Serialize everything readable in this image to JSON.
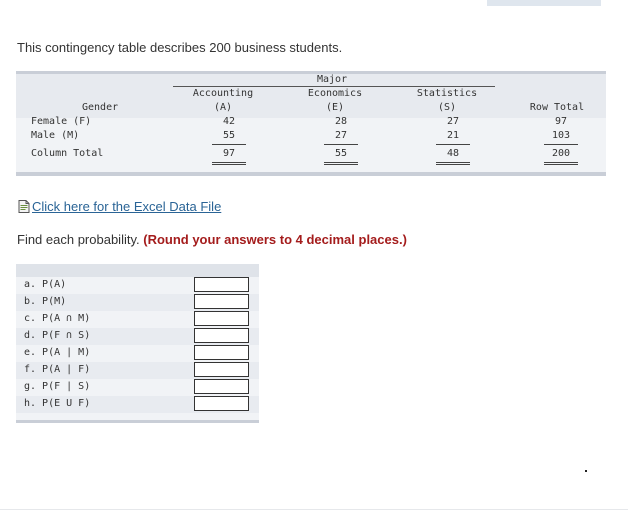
{
  "intro": "This contingency table describes 200 business students.",
  "table": {
    "major_label": "Major",
    "gender_label": "Gender",
    "columns": [
      {
        "name": "Accounting",
        "code": "(A)"
      },
      {
        "name": "Economics",
        "code": "(E)"
      },
      {
        "name": "Statistics",
        "code": "(S)"
      }
    ],
    "row_total_label": "Row Total",
    "rows": [
      {
        "label": "Female (F)",
        "values": [
          "42",
          "28",
          "27"
        ],
        "total": "97"
      },
      {
        "label": "Male (M)",
        "values": [
          "55",
          "27",
          "21"
        ],
        "total": "103"
      }
    ],
    "column_total": {
      "label": "Column Total",
      "values": [
        "97",
        "55",
        "48"
      ],
      "total": "200"
    }
  },
  "excel_link": "Click here for the Excel Data File",
  "instructions": {
    "prefix": "Find each probability.",
    "emphasis": "(Round your answers to 4 decimal places.)"
  },
  "questions": [
    {
      "label": "a. P(A)",
      "value": ""
    },
    {
      "label": "b. P(M)",
      "value": ""
    },
    {
      "label": "c. P(A ∩ M)",
      "value": ""
    },
    {
      "label": "d. P(F ∩ S)",
      "value": ""
    },
    {
      "label": "e. P(A | M)",
      "value": ""
    },
    {
      "label": "f. P(A | F)",
      "value": ""
    },
    {
      "label": "g. P(F | S)",
      "value": ""
    },
    {
      "label": "h. P(E U F)",
      "value": ""
    }
  ],
  "colors": {
    "link": "#2a6496",
    "emphasis": "#a41c1c",
    "panel": "#f1f3f6",
    "rule": "#c9ced7"
  },
  "icons": {
    "excel": "document-icon"
  }
}
